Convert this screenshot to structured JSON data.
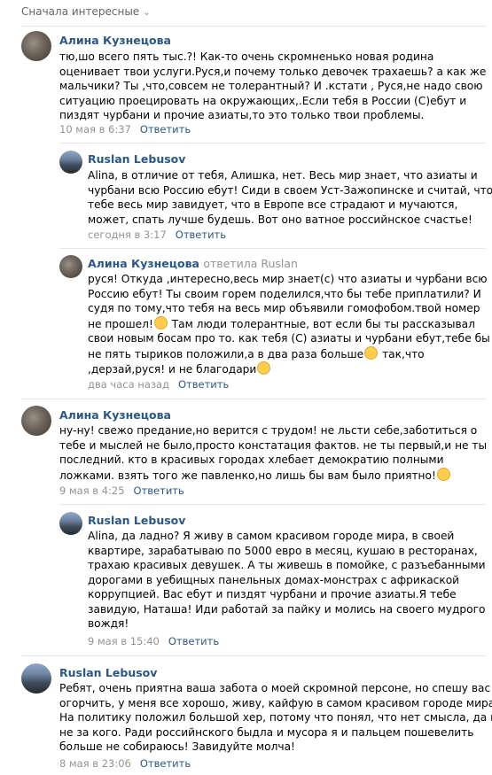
{
  "sort": {
    "label": "Сначала интересные",
    "icon": "chevron-down-icon"
  },
  "comments": [
    {
      "author": "Алина Кузнецова",
      "avatar": "cat-avatar",
      "lines": [
        "тю,шо всего пять тыс.?! Как-то очень скромненько новая родина",
        "оценивает твои услуги.Руся,и почему только девочек трахаешь? а как же",
        "мальчики? Ты ,что,совсем не толерантный? И .кстати , Руся,не надо свою",
        "ситуацию проецировать на окружающих,.Если тебя в России (С)ебут и",
        "пиздят чурбани и прочие азиаты,то это только твои проблемы."
      ],
      "date": "10 мая в 6:37",
      "reply": "Ответить"
    },
    {
      "author": "Ruslan Lebusov",
      "avatar": "city-avatar",
      "lines": [
        "Alina, в отличие от тебя, Алишка, нет. Весь мир знает, что азиаты и",
        "чурбани всю Россию ебут! Сиди в своем Уст-Зажопинске и считай, что",
        "тебе весь мир завидует, что в Европе все страдают и мучаются,",
        "может, спать лучше будешь. Вот оно ватное российнское счастье!"
      ],
      "date": "сегодня в 3:17",
      "reply": "Ответить"
    },
    {
      "author": "Алина Кузнецова",
      "reply_to": "ответила Ruslan",
      "avatar": "cat-avatar",
      "lines": [
        "руся! Откуда ,интересно,весь мир знает(с) что азиаты и чурбани всю",
        "Россию ебут! Ты своим горем поделился,что бы тебе приплатили? И",
        "судя по тому,что тебя на весь мир объявили гомофобом.твой номер",
        "не прошел!",
        "Там люди толерантные, вот если бы ты рассказывал",
        "свои новым босам про то. как тебя (С) азиаты и чурбани ебут,тебе бы",
        "не пять тыриков положили,а в два раза больше",
        "так,что",
        ",дерзай,руся! и не благодари"
      ],
      "date": "два часа назад",
      "reply": "Ответить"
    },
    {
      "author": "Алина Кузнецова",
      "avatar": "cat-avatar",
      "lines": [
        "ну-ну! свежо предание,но верится с трудом! не льсти себе,заботиться о",
        "тебе и мыслей не было,просто констатация фактов. не ты первый,и не ты",
        "последний. кто в красивых городах хлебает демократию полными",
        "ложками. взять того же павленко,но лишь бы вам было приятно!"
      ],
      "date": "9 мая в 4:25",
      "reply": "Ответить"
    },
    {
      "author": "Ruslan Lebusov",
      "avatar": "city-avatar",
      "lines": [
        "Alina, да ладно? Я живу в самом красивом городе мира, в своей",
        "квартире, зарабатываю по 5000 евро в месяц, кушаю в ресторанах,",
        "трахаю красивых девушек. А ты живешь в помойке, с разъебанными",
        "дорогами в уебищных панельных домах-монстрах с африкаской",
        "коррупцией. Вас ебут и пиздят чурбани и прочие азиаты.Я тебе",
        "завидую, Наташа! Иди работай за пайку и молись на своего мудрого",
        "вождя!"
      ],
      "date": "9 мая в 15:40",
      "reply": "Ответить"
    },
    {
      "author": "Ruslan Lebusov",
      "avatar": "city-avatar",
      "lines": [
        "Ребят, очень приятна ваша забота о моей скромной персоне, но спешу вас",
        "огорчить, у меня все хорошо, живу, кайфую в самом красивом городе мира!",
        "На политику положил большой хер, потому что понял, что нет смысла, да и",
        "не за кого. Ради российнского быдла и мусора я и пальцем пошевелить",
        "больше не собираюсь! Завидуйте молча!"
      ],
      "date": "8 мая в 23:06",
      "reply": "Ответить"
    }
  ]
}
